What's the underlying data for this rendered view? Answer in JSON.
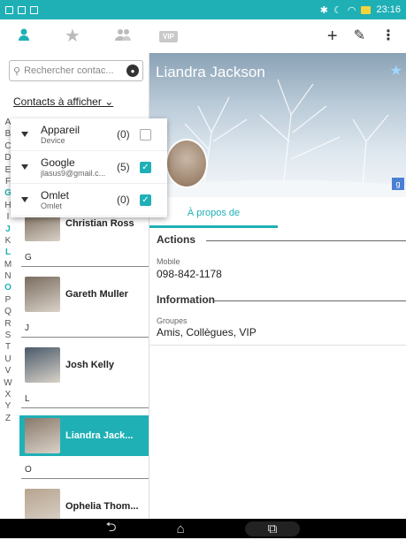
{
  "status_bar": {
    "time": "23:16"
  },
  "toolbar": {
    "vip_label": "VIP",
    "add_icon": "plus-icon",
    "edit_icon": "pencil-icon",
    "menu_icon": "more-vertical-icon"
  },
  "search": {
    "placeholder": "Rechercher contac..."
  },
  "contacts_filter": {
    "label": "Contacts à afficher"
  },
  "popup": {
    "rows": [
      {
        "name": "Appareil",
        "sub": "Device",
        "count": "(0)",
        "checked": false
      },
      {
        "name": "Google",
        "sub": "jlasus9@gmail.c...",
        "count": "(5)",
        "checked": true
      },
      {
        "name": "Omlet",
        "sub": "Omlet",
        "count": "(0)",
        "checked": true
      }
    ]
  },
  "alpha_index": [
    "A",
    "B",
    "C",
    "D",
    "E",
    "F",
    "G",
    "H",
    "I",
    "J",
    "K",
    "L",
    "M",
    "N",
    "O",
    "P",
    "Q",
    "R",
    "S",
    "T",
    "U",
    "V",
    "W",
    "X",
    "Y",
    "Z"
  ],
  "alpha_highlight": [
    "G",
    "J",
    "L",
    "O"
  ],
  "contacts": [
    {
      "name": "Christian Ross"
    },
    {
      "section": "G"
    },
    {
      "name": "Gareth Muller"
    },
    {
      "section": "J"
    },
    {
      "name": "Josh Kelly"
    },
    {
      "section": "L"
    },
    {
      "name": "Liandra Jack...",
      "selected": true
    },
    {
      "section": "O"
    },
    {
      "name": "Ophelia Thom..."
    }
  ],
  "detail": {
    "name": "Liandra Jackson",
    "tab_label": "À propos de",
    "actions_header": "Actions",
    "mobile_label": "Mobile",
    "mobile_value": "098-842-1178",
    "info_header": "Information",
    "groups_label": "Groupes",
    "groups_value": "Amis, Collègues, VIP",
    "source_badge": "g"
  },
  "colors": {
    "accent": "#1fb0b6"
  }
}
